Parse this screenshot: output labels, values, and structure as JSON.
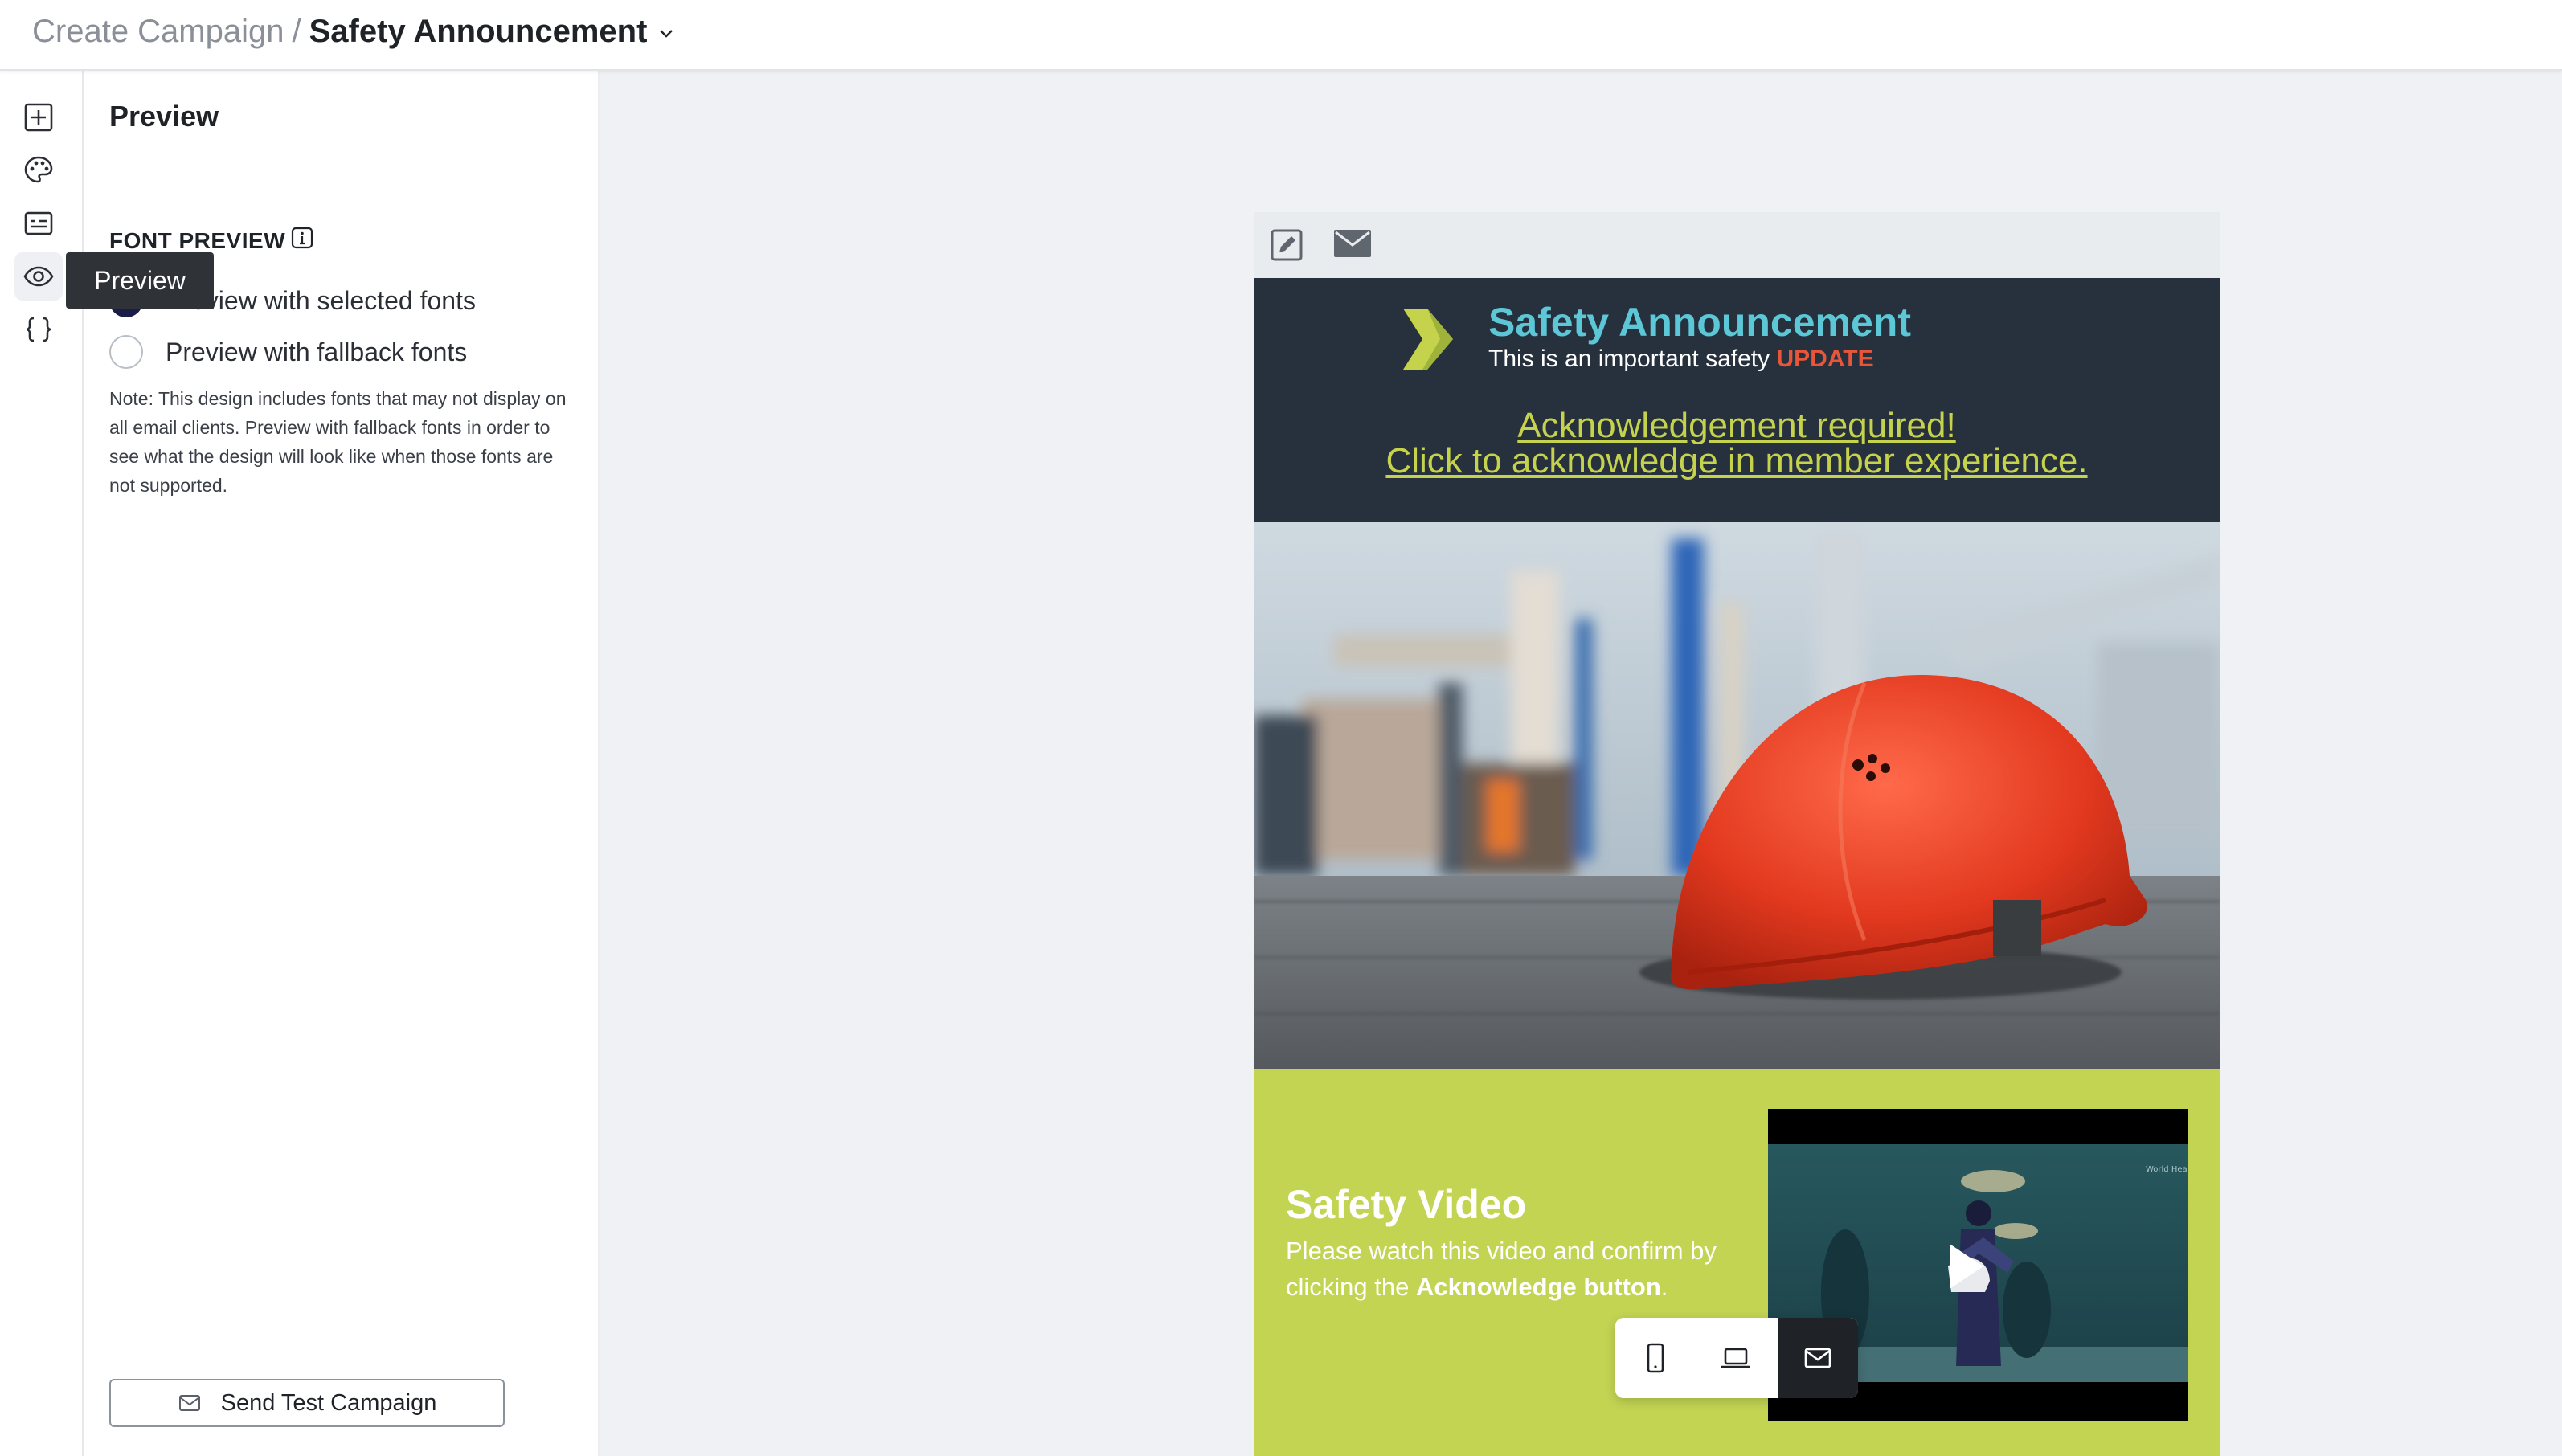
{
  "breadcrumb": {
    "root": "Create Campaign",
    "separator": "/",
    "current": "Safety Announcement"
  },
  "sidebar_icons": [
    "add-block-icon",
    "palette-icon",
    "layout-icon",
    "eye-icon",
    "code-braces-icon"
  ],
  "tooltip": {
    "text": "Preview"
  },
  "panel": {
    "title": "Preview",
    "font_preview_label": "FONT PREVIEW",
    "options": [
      {
        "label": "Preview with selected fonts",
        "checked": true
      },
      {
        "label": "Preview with fallback fonts",
        "checked": false
      }
    ],
    "note": "Note: This design includes fonts that may not display on all email clients. Preview with fallback fonts in order to see what the design will look like when those fonts are not supported.",
    "send_button": "Send Test Campaign"
  },
  "email": {
    "title": "Safety Announcement",
    "subtitle_prefix": "This is an important safety ",
    "subtitle_highlight": "UPDATE",
    "ack_line1": "Acknowledgement required!",
    "ack_line2": "Click to acknowledge in member experience.",
    "video_title": "Safety Video",
    "video_body_prefix": "Please watch this video and confirm by clicking the ",
    "video_body_bold": "Acknowledge button",
    "video_body_suffix": "."
  },
  "device_toggle": {
    "options": [
      "mobile-icon",
      "desktop-icon",
      "email-icon"
    ],
    "active": "email-icon"
  },
  "colors": {
    "header_dark": "#26313d",
    "title_teal": "#5cc7d6",
    "update_red": "#e8563a",
    "lime": "#c3d453",
    "ack_lime": "#c5d24c"
  }
}
